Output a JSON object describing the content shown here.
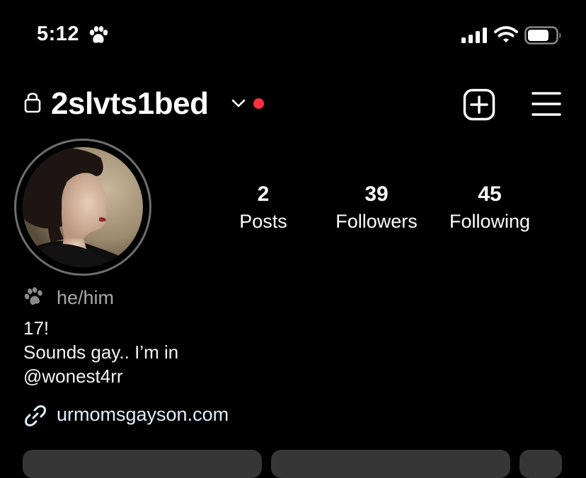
{
  "status_bar": {
    "time": "5:12"
  },
  "header": {
    "username": "2slvts1bed"
  },
  "stats": [
    {
      "value": "2",
      "label": "Posts"
    },
    {
      "value": "39",
      "label": "Followers"
    },
    {
      "value": "45",
      "label": "Following"
    }
  ],
  "bio": {
    "pronouns": "he/him",
    "lines": [
      "17!",
      "Sounds gay.. I’m in",
      "@wonest4rr"
    ],
    "link": "urmomsgayson.com"
  },
  "colors": {
    "background": "#000000",
    "notification_dot": "#ff3040",
    "button_bg": "#363636",
    "secondary_text": "#a8a8a8"
  },
  "icons": {
    "status": "paw-icon",
    "pronoun": "paw-icon",
    "link": "link-icon",
    "lock": "lock-icon",
    "new_post": "plus-square-icon",
    "menu": "hamburger-icon"
  }
}
